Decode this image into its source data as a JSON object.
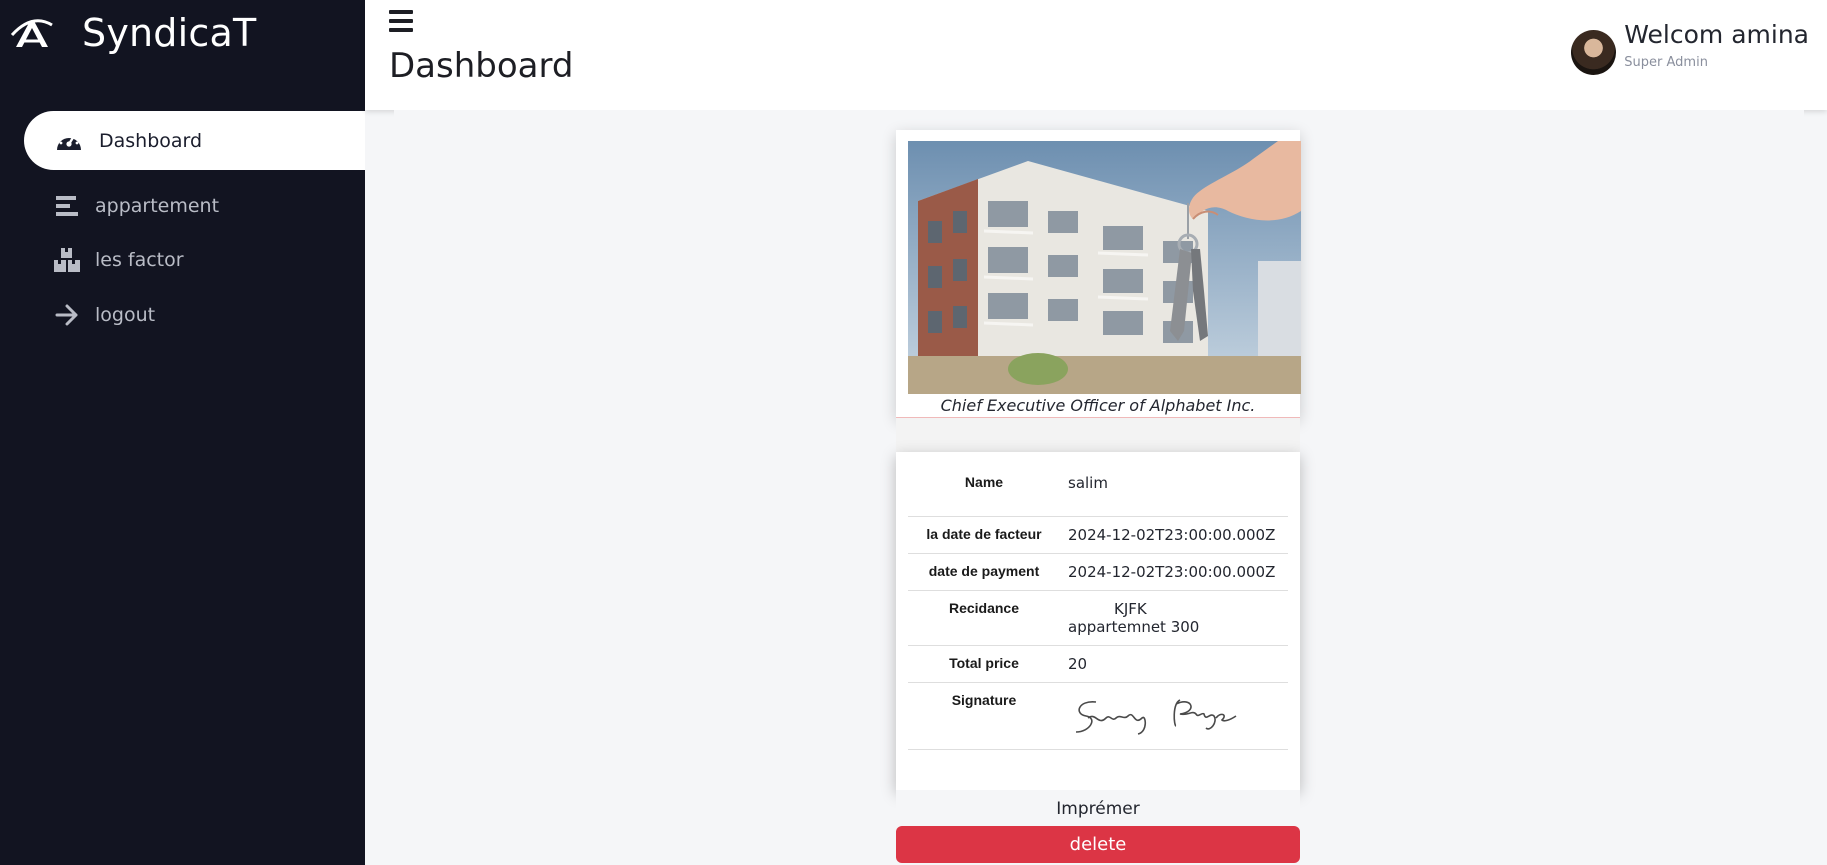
{
  "brand": {
    "name": "SyndicaT"
  },
  "sidebar": {
    "items": [
      {
        "label": "Dashboard",
        "icon": "speedometer-icon",
        "active": true
      },
      {
        "label": "appartement",
        "icon": "list-icon"
      },
      {
        "label": "les factor",
        "icon": "boxes-icon"
      },
      {
        "label": "logout",
        "icon": "arrow-right-icon"
      }
    ]
  },
  "header": {
    "title": "Dashboard",
    "welcome": "Welcom amina",
    "role": "Super Admin"
  },
  "card": {
    "caption": "Chief Executive Officer of Alphabet Inc.",
    "rows": {
      "name_label": "Name",
      "name_value": "salim",
      "invoice_date_label": "la date de facteur",
      "invoice_date_value": "2024-12-02T23:00:00.000Z",
      "payment_date_label": "date de payment",
      "payment_date_value": "2024-12-02T23:00:00.000Z",
      "residence_label": "Recidance",
      "residence_value": "KJFK",
      "apartment_value": "appartemnet 300",
      "total_label": "Total price",
      "total_value": "20",
      "signature_label": "Signature",
      "signature_value": "Larry Page"
    },
    "print_label": "Imprémer",
    "delete_label": "delete"
  },
  "colors": {
    "sidebar_bg": "#121421",
    "delete_bg": "#dc3545"
  }
}
